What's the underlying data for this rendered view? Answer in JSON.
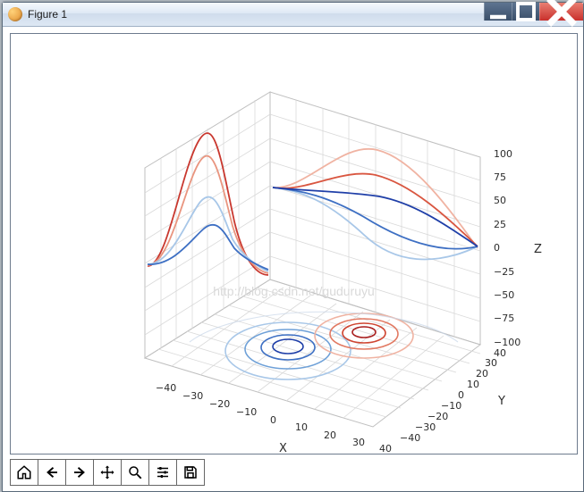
{
  "window": {
    "title": "Figure 1"
  },
  "toolbar": {
    "home": "Home",
    "back": "Back",
    "forward": "Forward",
    "pan": "Pan",
    "zoom": "Zoom",
    "configure": "Configure subplots",
    "save": "Save"
  },
  "watermark": "http://blog.csdn.net/guduruyu",
  "chart_data": {
    "type": "3d-contour-projections",
    "title": "",
    "xlabel": "X",
    "ylabel": "Y",
    "zlabel": "Z",
    "x_ticks": [
      -40,
      -30,
      -20,
      -10,
      0,
      10,
      20,
      30,
      40
    ],
    "y_ticks": [
      -40,
      -30,
      -20,
      -10,
      0,
      10,
      20,
      30,
      40
    ],
    "z_ticks": [
      -100,
      -75,
      -50,
      -25,
      0,
      25,
      50,
      75,
      100
    ],
    "xlim": [
      -40,
      40
    ],
    "ylim": [
      -40,
      40
    ],
    "zlim": [
      -100,
      100
    ],
    "description": "Three orthogonal contour projections of a surface resembling the difference of two 2D Gaussians (positive near (+x,+y), negative near (-x,-y)). Contour levels drawn on Z floor, X back-wall (x = -40), and Y back-wall (y = 40) in a coolwarm colormap.",
    "colormap": "coolwarm",
    "contour_levels": [
      -80,
      -60,
      -40,
      -20,
      0,
      20,
      40,
      60,
      80
    ],
    "floor_contours_hint": {
      "positive_center_xy": [
        15,
        5
      ],
      "negative_center_xy": [
        -5,
        -5
      ]
    }
  }
}
